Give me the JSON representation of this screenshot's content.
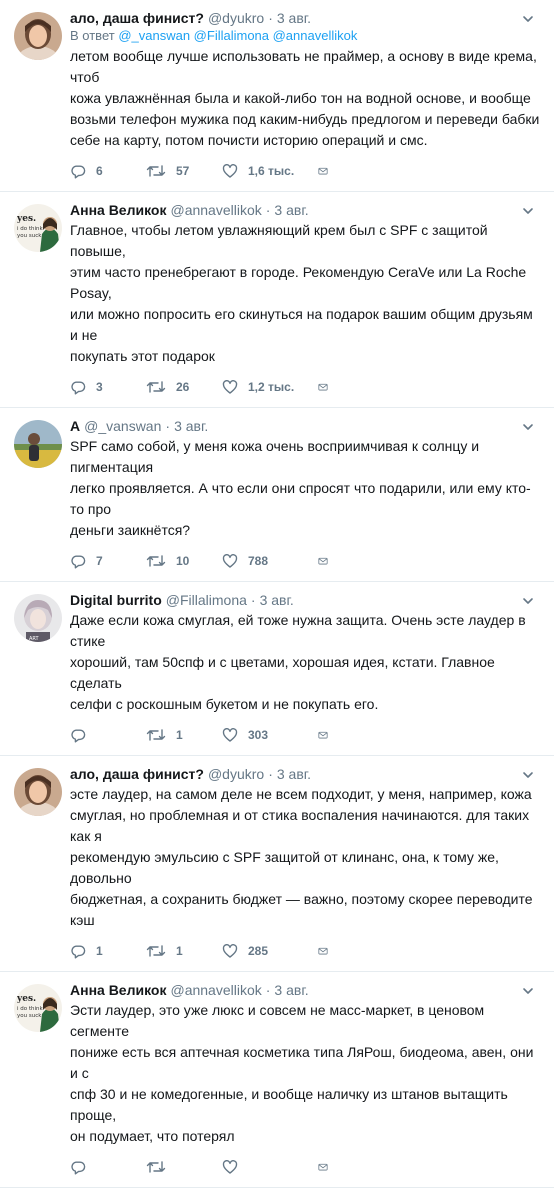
{
  "thread": [
    {
      "name": "ало, даша финист?",
      "handle": "@dyukro",
      "time": "3 авг.",
      "avatar": "avatar-1",
      "reply_to": {
        "prefix": "В ответ",
        "users": "@_vanswan @Fillalimona @annavellikok"
      },
      "text": "летом вообще лучше использовать не праймер, а основу в виде крема, чтоб\nкожа увлажнённая была и какой-либо тон на водной основе, и вообще\nвозьми телефон мужика под каким-нибудь предлогом и переведи бабки\nсебе на карту, потом почисти историю операций и смс.",
      "replies": "6",
      "retweets": "57",
      "likes": "1,6 тыс."
    },
    {
      "name": "Анна Великок",
      "handle": "@annavellikok",
      "time": "3 авг.",
      "avatar": "avatar-2",
      "text": "Главное, чтобы летом увлажняющий крем был с SPF с защитой повыше,\nэтим часто пренебрегают в городе. Рекомендую CeraVe или La Roche Posay,\nили можно попросить его скинуться на подарок вашим общим друзьям и не\nпокупать этот подарок",
      "replies": "3",
      "retweets": "26",
      "likes": "1,2 тыс."
    },
    {
      "name": "А",
      "handle": "@_vanswan",
      "time": "3 авг.",
      "avatar": "avatar-3",
      "text": "SPF само собой, у меня кожа очень восприимчивая к солнцу и пигментация\nлегко проявляется. А что если они спросят что подарили, или ему кто-то про\nденьги заикнётся?",
      "replies": "7",
      "retweets": "10",
      "likes": "788"
    },
    {
      "name": "Digital burrito",
      "handle": "@Fillalimona",
      "time": "3 авг.",
      "avatar": "avatar-4",
      "text": "Даже если кожа смуглая, ей тоже нужна защита. Очень эсте лаудер в стике\nхороший, там 50спф и с цветами, хорошая идея, кстати. Главное сделать\nселфи с роскошным букетом и не покупать его.",
      "replies": "",
      "retweets": "1",
      "likes": "303"
    },
    {
      "name": "ало, даша финист?",
      "handle": "@dyukro",
      "time": "3 авг.",
      "avatar": "avatar-1",
      "text": "эсте лаудер, на самом деле не всем подходит, у меня, например, кожа\nсмуглая, но проблемная и от стика воспаления начинаются. для таких как я\nрекомендую эмульсию с SPF защитой от клинанс, она, к тому же, довольно\nбюджетная, а сохранить бюджет — важно, поэтому скорее переводите кэш",
      "replies": "1",
      "retweets": "1",
      "likes": "285"
    },
    {
      "name": "Анна Великок",
      "handle": "@annavellikok",
      "time": "3 авг.",
      "avatar": "avatar-2",
      "text": "Эсти лаудер, это уже люкс и совсем не масс-маркет, в ценовом сегменте\nпониже есть вся аптечная косметика типа ЛяРош, биодеома, авен, они и с\nспф 30 и не комедогенные, и вообще наличку из штанов вытащить проще,\nон подумает, что потерял",
      "replies": "",
      "retweets": "",
      "likes": ""
    }
  ],
  "icons": {
    "reply": "reply-icon",
    "retweet": "retweet-icon",
    "like": "heart-icon",
    "dm": "envelope-icon",
    "menu": "chevron-down-icon"
  },
  "colors": {
    "text": "#14171a",
    "muted": "#657786",
    "link": "#1da1f2",
    "divider": "#e6ecf0"
  }
}
